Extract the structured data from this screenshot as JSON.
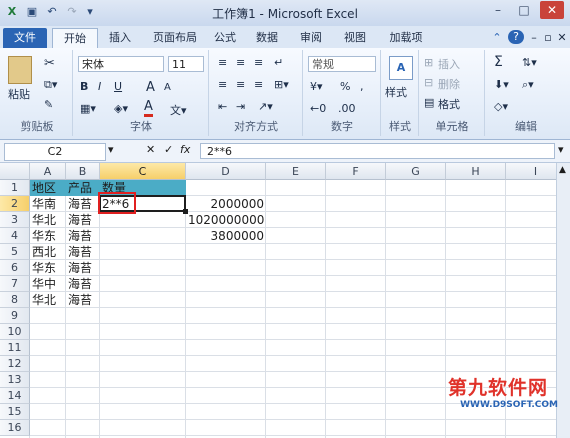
{
  "window": {
    "title": "工作簿1 - Microsoft Excel",
    "help": "?"
  },
  "tabs": [
    "文件",
    "开始",
    "插入",
    "页面布局",
    "公式",
    "数据",
    "审阅",
    "视图",
    "加载项"
  ],
  "ribbon": {
    "clipboard": {
      "label": "剪贴板",
      "paste": "粘贴"
    },
    "font": {
      "label": "字体",
      "name": "宋体",
      "size": "11",
      "bold": "B",
      "italic": "I",
      "underline": "U",
      "grow": "A",
      "shrink": "A",
      "color": "A"
    },
    "alignment": {
      "label": "对齐方式"
    },
    "number": {
      "label": "数字",
      "format": "常规",
      "percent": "%",
      "comma": ","
    },
    "styles": {
      "label": "样式",
      "button": "样式"
    },
    "cells": {
      "label": "单元格",
      "insert": "插入",
      "delete": "删除",
      "format": "格式"
    },
    "editing": {
      "label": "编辑",
      "sum": "Σ"
    }
  },
  "formula_bar": {
    "name_box": "C2",
    "cancel": "✕",
    "enter": "✓",
    "fx": "fx",
    "content": "2**6"
  },
  "grid": {
    "columns": [
      "A",
      "B",
      "C",
      "D",
      "E",
      "F",
      "G",
      "H",
      "I"
    ],
    "rows": [
      "1",
      "2",
      "3",
      "4",
      "5",
      "6",
      "7",
      "8",
      "9",
      "10",
      "11",
      "12",
      "13",
      "14",
      "15",
      "16"
    ],
    "headers": [
      "地区",
      "产品",
      "数量"
    ],
    "data": [
      [
        "华南",
        "海苔",
        "2**6",
        "2000000"
      ],
      [
        "华北",
        "海苔",
        "",
        "1020000000"
      ],
      [
        "华东",
        "海苔",
        "",
        "3800000"
      ],
      [
        "西北",
        "海苔",
        "",
        ""
      ],
      [
        "华东",
        "海苔",
        "",
        ""
      ],
      [
        "华中",
        "海苔",
        "",
        ""
      ],
      [
        "华北",
        "海苔",
        "",
        ""
      ]
    ],
    "active_cell": "C2",
    "header_fill": "#4bacc6"
  },
  "watermark": {
    "title": "第九软件网",
    "url": "WWW.D9SOFT.COM"
  }
}
